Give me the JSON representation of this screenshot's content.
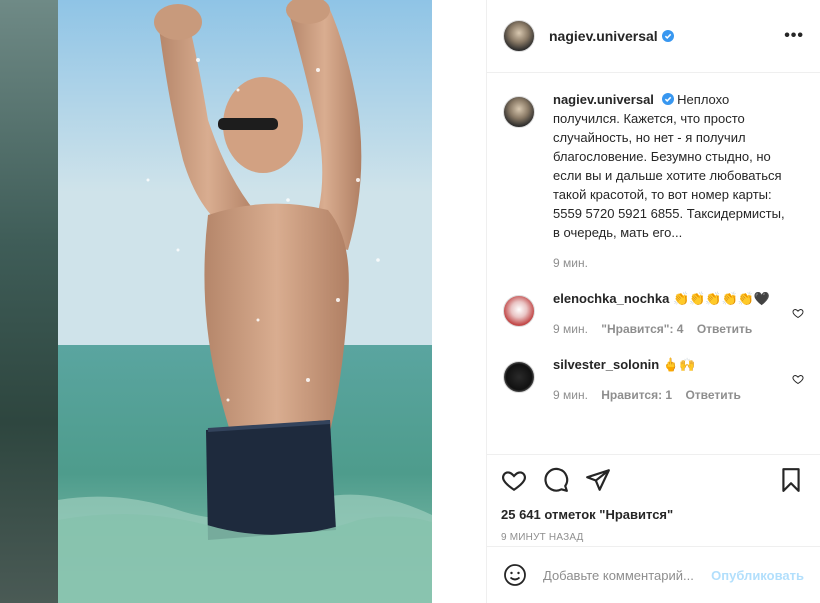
{
  "post": {
    "username": "nagiev.universal",
    "more_icon": "more-horizontal-icon"
  },
  "caption": {
    "username": "nagiev.universal",
    "text": "Неплохо получился. Кажется, что просто случайность, но нет - я получил благословение. Безумно стыдно, но если вы и дальше хотите любоваться такой красотой, то вот номер карты: 5559 5720 5921 6855. Таксидермисты, в очередь, мать его...",
    "time": "9 мин."
  },
  "comments": [
    {
      "username": "elenochka_nochka",
      "text": "👏👏👏👏👏🖤",
      "time": "9 мин.",
      "likes": "\"Нравится\": 4",
      "reply": "Ответить"
    },
    {
      "username": "silvester_solonin",
      "text": "🖕🙌",
      "time": "9 мин.",
      "likes": "Нравится: 1",
      "reply": "Ответить"
    }
  ],
  "stats": {
    "likes": "25 641 отметок \"Нравится\"",
    "time_ago": "9 МИНУТ НАЗАД"
  },
  "add_comment": {
    "placeholder": "Добавьте комментарий...",
    "publish": "Опубликовать"
  },
  "colors": {
    "verified": "#3897f0",
    "link_disabled": "#b2dffc",
    "muted": "#8e8e8e"
  }
}
